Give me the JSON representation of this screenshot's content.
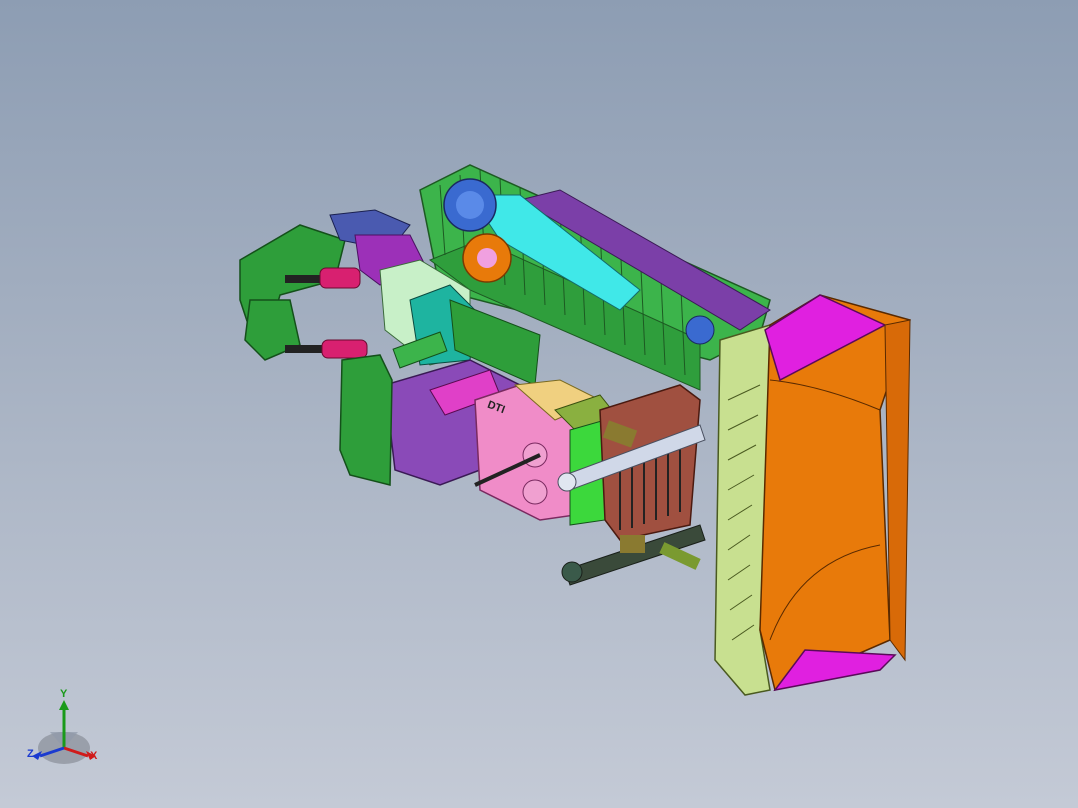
{
  "viewport": {
    "background_top": "#8d9db3",
    "background_bottom": "#c4cad6"
  },
  "model": {
    "part_label": "DTI",
    "colors": {
      "track": "#3cb44b",
      "frame": "#7b3fa8",
      "cylinder": "#40e8e8",
      "blade_face": "#e87a0a",
      "blade_edge": "#e020e0",
      "blade_frame": "#c8e090",
      "engine": "#f08cc8",
      "radiator": "#a05040",
      "cab": "#1eb4a0",
      "rear_ripper": "#2e9e3a",
      "hydraulic": "#d82070"
    }
  },
  "triad": {
    "icon": "coordinate-triad-icon",
    "x_label": "X",
    "y_label": "Y",
    "z_label": "Z",
    "x_color": "#d01a1a",
    "y_color": "#1a9a1a",
    "z_color": "#1a3ad0"
  }
}
